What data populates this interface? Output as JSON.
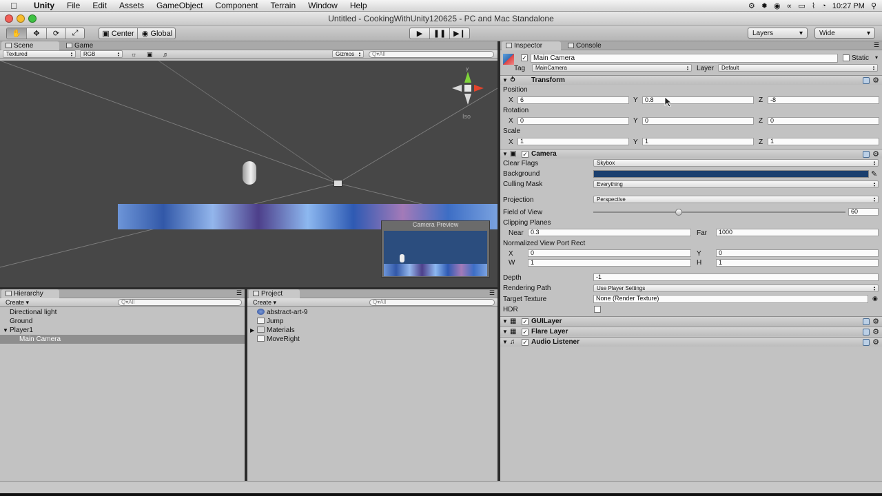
{
  "menubar": {
    "app": "Unity",
    "items": [
      "File",
      "Edit",
      "Assets",
      "GameObject",
      "Component",
      "Terrain",
      "Window",
      "Help"
    ],
    "clock": "10:27 PM"
  },
  "window": {
    "title": "Untitled - CookingWithUnity120625 - PC and Mac Standalone"
  },
  "toolbar": {
    "pivot": "Center",
    "space": "Global",
    "layers": "Layers",
    "layout": "Wide"
  },
  "scene": {
    "tab_scene": "Scene",
    "tab_game": "Game",
    "render_mode": "Textured",
    "channel": "RGB",
    "gizmos": "Gizmos",
    "search_placeholder": "Q▾All",
    "iso_label": "Iso",
    "camera_preview": "Camera Preview"
  },
  "hierarchy": {
    "title": "Hierarchy",
    "create": "Create",
    "search_placeholder": "Q▾All",
    "items": [
      {
        "label": "Directional light"
      },
      {
        "label": "Ground"
      },
      {
        "label": "Player1"
      },
      {
        "label": "Main Camera"
      }
    ]
  },
  "project": {
    "title": "Project",
    "create": "Create",
    "search_placeholder": "Q▾All",
    "items": [
      {
        "label": "abstract-art-9"
      },
      {
        "label": "Jump"
      },
      {
        "label": "Materials"
      },
      {
        "label": "MoveRight"
      }
    ]
  },
  "inspector": {
    "tab_inspector": "Inspector",
    "tab_console": "Console",
    "object_name": "Main Camera",
    "static_label": "Static",
    "tag_label": "Tag",
    "tag_value": "MainCamera",
    "layer_label": "Layer",
    "layer_value": "Default",
    "transform": {
      "name": "Transform",
      "position_label": "Position",
      "rotation_label": "Rotation",
      "scale_label": "Scale",
      "x": "X",
      "y": "Y",
      "z": "Z",
      "position": {
        "x": "6",
        "y": "0.8",
        "z": "-8"
      },
      "rotation": {
        "x": "0",
        "y": "0",
        "z": "0"
      },
      "scale": {
        "x": "1",
        "y": "1",
        "z": "1"
      }
    },
    "camera": {
      "name": "Camera",
      "clear_flags_label": "Clear Flags",
      "clear_flags": "Skybox",
      "background_label": "Background",
      "background_color": "#1b3f6e",
      "culling_mask_label": "Culling Mask",
      "culling_mask": "Everything",
      "projection_label": "Projection",
      "projection": "Perspective",
      "fov_label": "Field of View",
      "fov": "60",
      "clipping_label": "Clipping Planes",
      "near_label": "Near",
      "near": "0.3",
      "far_label": "Far",
      "far": "1000",
      "viewport_label": "Normalized View Port Rect",
      "vp_x_label": "X",
      "vp_x": "0",
      "vp_y_label": "Y",
      "vp_y": "0",
      "vp_w_label": "W",
      "vp_w": "1",
      "vp_h_label": "H",
      "vp_h": "1",
      "depth_label": "Depth",
      "depth": "-1",
      "rendering_path_label": "Rendering Path",
      "rendering_path": "Use Player Settings",
      "target_texture_label": "Target Texture",
      "target_texture": "None (Render Texture)",
      "hdr_label": "HDR"
    },
    "components": [
      "GUILayer",
      "Flare Layer",
      "Audio Listener"
    ]
  }
}
